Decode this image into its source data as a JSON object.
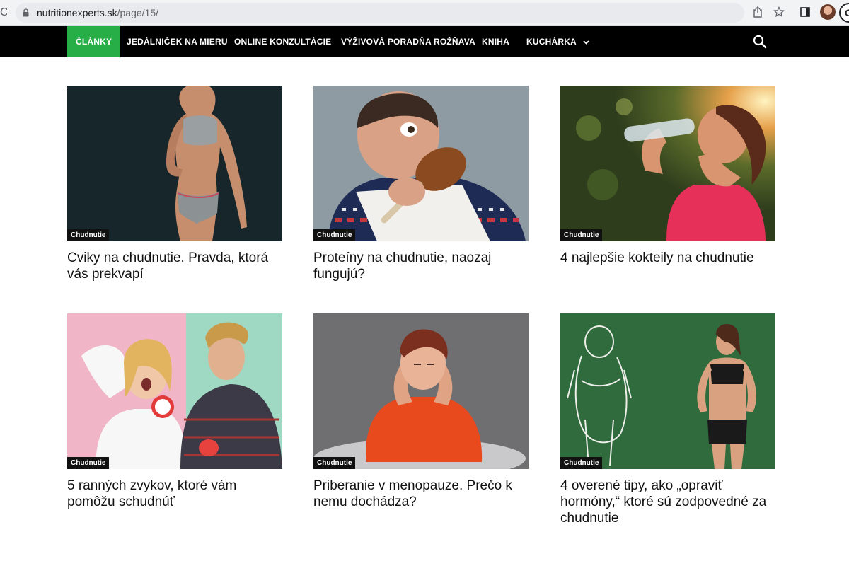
{
  "browser": {
    "url_host": "nutritionexperts.sk",
    "url_path": "/page/15/",
    "profile_initial": "G"
  },
  "nav": {
    "items": [
      {
        "label": "ČLÁNKY",
        "active": true
      },
      {
        "label": "JEDÁLNIČEK NA MIERU"
      },
      {
        "label": "ONLINE KONZULTÁCIE"
      },
      {
        "label": "VÝŽIVOVÁ PORADŇA ROŽŇAVA"
      },
      {
        "label": "KNIHA"
      },
      {
        "label": "KUCHÁRKA"
      }
    ],
    "accent_color": "#27ae47"
  },
  "articles": [
    {
      "category": "Chudnutie",
      "title": "Cviky na chudnutie. Pravda, ktorá vás prekvapí"
    },
    {
      "category": "Chudnutie",
      "title": "Proteíny na chudnutie, naozaj fungujú?"
    },
    {
      "category": "Chudnutie",
      "title": "4 najlepšie kokteily na chudnutie"
    },
    {
      "category": "Chudnutie",
      "title": "5 ranných zvykov, ktoré vám pomôžu schudnúť"
    },
    {
      "category": "Chudnutie",
      "title": "Priberanie v menopauze. Prečo k nemu dochádza?"
    },
    {
      "category": "Chudnutie",
      "title": "4 overené tipy, ako „opraviť hormóny,“ ktoré sú zodpovedné za chudnutie"
    }
  ]
}
